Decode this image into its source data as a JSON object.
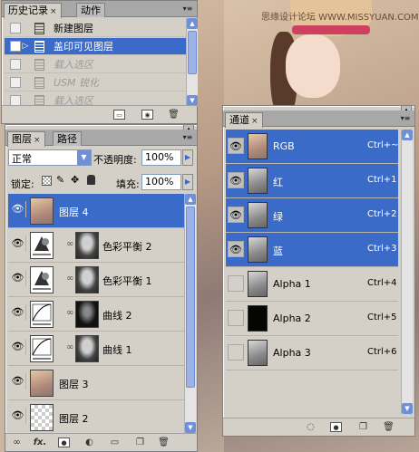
{
  "background": {
    "watermark": "思缘设计论坛  WWW.MISSYUAN.COM"
  },
  "history_panel": {
    "tabs": [
      {
        "label": "历史记录",
        "close": "×"
      },
      {
        "label": "动作"
      }
    ],
    "items": [
      {
        "label": "新建图层",
        "state": "normal"
      },
      {
        "label": "盖印可见图层",
        "state": "selected"
      },
      {
        "label": "载入选区",
        "state": "dim"
      },
      {
        "label": "USM 锐化",
        "state": "dim"
      },
      {
        "label": "载入选区",
        "state": "dim"
      }
    ],
    "bottom_icons": [
      "new-document-from-state-icon",
      "new-snapshot-icon",
      "delete-icon"
    ]
  },
  "layers_panel": {
    "tabs": [
      {
        "label": "图层",
        "close": "×"
      },
      {
        "label": "路径"
      }
    ],
    "blend_mode": "正常",
    "opacity_label": "不透明度:",
    "opacity_value": "100%",
    "lock_label": "锁定:",
    "fill_label": "填充:",
    "fill_value": "100%",
    "layers": [
      {
        "name": "图层 4",
        "thumb": "photo",
        "selected": true
      },
      {
        "name": "色彩平衡 2",
        "thumb": "color-balance",
        "mask": true
      },
      {
        "name": "色彩平衡 1",
        "thumb": "color-balance",
        "mask": true
      },
      {
        "name": "曲线 2",
        "thumb": "curves",
        "mask": true
      },
      {
        "name": "曲线 1",
        "thumb": "curves",
        "mask": true
      },
      {
        "name": "图层 3",
        "thumb": "photo"
      },
      {
        "name": "图层 2",
        "thumb": "transparent"
      }
    ],
    "bottom_icons": [
      "link-icon",
      "fx-icon",
      "mask-icon",
      "adjustment-icon",
      "group-icon",
      "new-layer-icon",
      "delete-icon"
    ],
    "fx_label": "fx."
  },
  "channels_panel": {
    "tabs": [
      {
        "label": "通道",
        "close": "×"
      }
    ],
    "channels": [
      {
        "name": "RGB",
        "shortcut": "Ctrl+~",
        "thumb": "color",
        "visible": true,
        "selected": true
      },
      {
        "name": "红",
        "shortcut": "Ctrl+1",
        "thumb": "gray",
        "visible": true,
        "selected": true
      },
      {
        "name": "绿",
        "shortcut": "Ctrl+2",
        "thumb": "gray",
        "visible": true,
        "selected": true
      },
      {
        "name": "蓝",
        "shortcut": "Ctrl+3",
        "thumb": "gray",
        "visible": true,
        "selected": true
      },
      {
        "name": "Alpha 1",
        "shortcut": "Ctrl+4",
        "thumb": "gray",
        "visible": false,
        "selected": false
      },
      {
        "name": "Alpha 2",
        "shortcut": "Ctrl+5",
        "thumb": "black",
        "visible": false,
        "selected": false
      },
      {
        "name": "Alpha 3",
        "shortcut": "Ctrl+6",
        "thumb": "gray",
        "visible": false,
        "selected": false
      }
    ],
    "bottom_icons": [
      "load-selection-icon",
      "save-selection-icon",
      "new-channel-icon",
      "delete-icon"
    ]
  },
  "colors": {
    "selection": "#3a6bc8",
    "panel": "#d4d0c8"
  }
}
